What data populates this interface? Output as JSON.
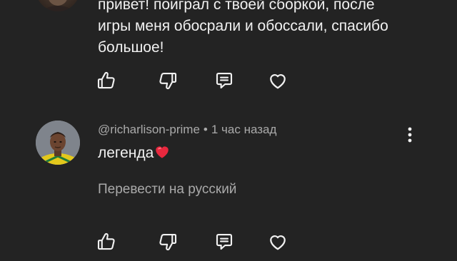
{
  "colors": {
    "background": "#232323",
    "text_primary": "#f1f1f1",
    "text_secondary": "#aaaaaa",
    "heart_emoji": "#e8283e"
  },
  "comments": [
    {
      "lines": [
        "привет! поиграл с твоей сборкой, после",
        "игры меня обосрали и обоссали, спасибо",
        "большое!"
      ],
      "actions": [
        "thumb-up-icon",
        "thumb-down-icon",
        "reply-icon",
        "heart-outline-icon"
      ]
    },
    {
      "author": "@richarlison-prime",
      "separator": "•",
      "time": "1 час назад",
      "text": "легенда",
      "emoji": "heart-emoji",
      "translate_label": "Перевести на русский",
      "actions": [
        "thumb-up-icon",
        "thumb-down-icon",
        "reply-icon",
        "heart-outline-icon"
      ]
    }
  ]
}
